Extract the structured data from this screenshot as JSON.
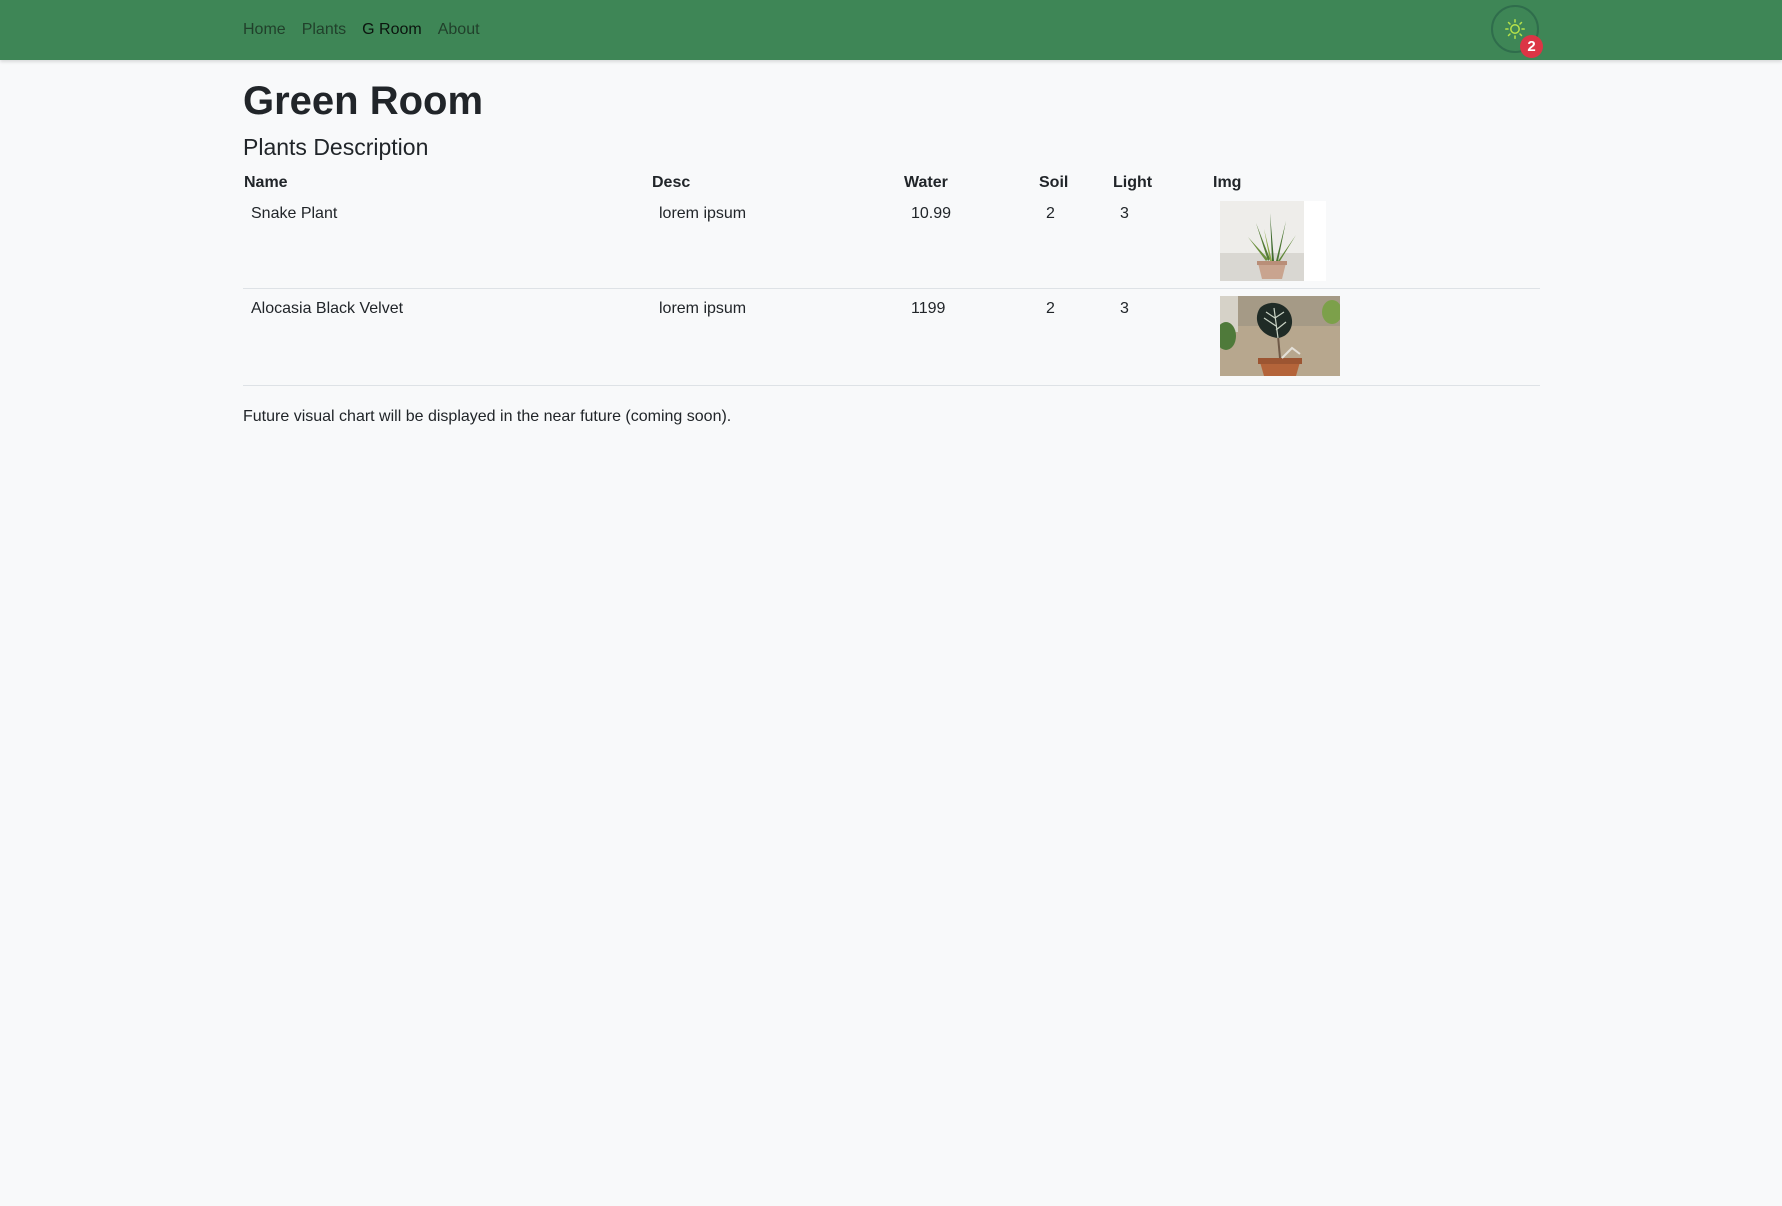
{
  "nav": {
    "links": [
      "Home",
      "Plants",
      "G Room",
      "About"
    ],
    "active": "G Room",
    "badge_count": "2",
    "cart_icon": "sun-icon"
  },
  "page": {
    "title": "Green Room",
    "subtitle": "Plants Description",
    "footnote": "Future visual chart will be displayed in the near future (coming soon)."
  },
  "table": {
    "headers": [
      "Name",
      "Desc",
      "Water",
      "Soil",
      "Light",
      "Img"
    ],
    "rows": [
      {
        "name": "Snake Plant",
        "desc": "lorem ipsum",
        "water": "10.99",
        "soil": "2",
        "light": "3",
        "img": "snake-plant-photo"
      },
      {
        "name": "Alocasia Black Velvet",
        "desc": "lorem ipsum",
        "water": "1199",
        "soil": "2",
        "light": "3",
        "img": "alocasia-photo"
      }
    ]
  },
  "colors": {
    "navbar": "#3e8656",
    "background": "#f8f9fa",
    "badge": "#dc3545"
  }
}
